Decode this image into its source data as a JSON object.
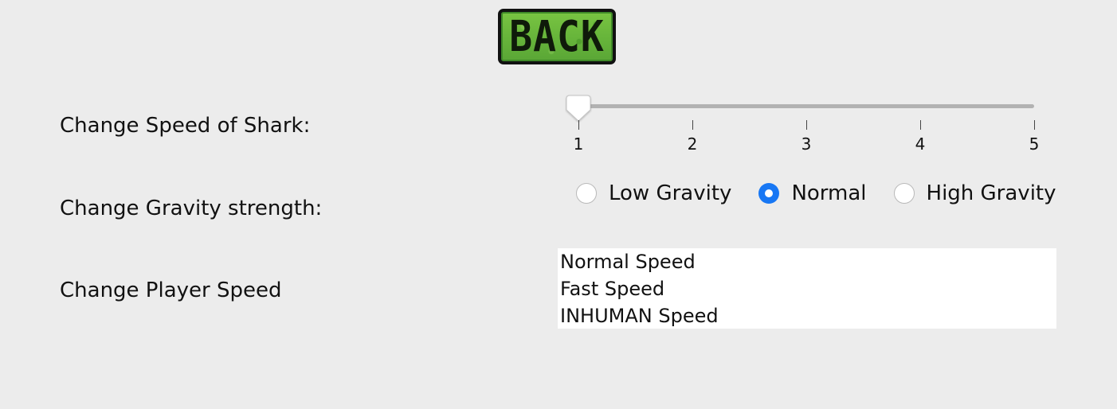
{
  "back_button": {
    "label": "BACK"
  },
  "settings": {
    "shark_speed": {
      "label": "Change Speed of Shark:",
      "min": 1,
      "max": 5,
      "value": 1,
      "ticks": [
        "1",
        "2",
        "3",
        "4",
        "5"
      ]
    },
    "gravity": {
      "label": "Change Gravity strength:",
      "options": [
        {
          "label": "Low Gravity",
          "checked": false
        },
        {
          "label": "Normal",
          "checked": true
        },
        {
          "label": "High Gravity",
          "checked": false
        }
      ]
    },
    "player_speed": {
      "label": "Change Player Speed",
      "options": [
        "Normal Speed",
        "Fast Speed",
        "INHUMAN Speed"
      ]
    }
  },
  "colors": {
    "background": "#ececec",
    "button_green": "#6cb83c",
    "radio_accent": "#1777f4",
    "slider_track": "#b2b2b2"
  }
}
